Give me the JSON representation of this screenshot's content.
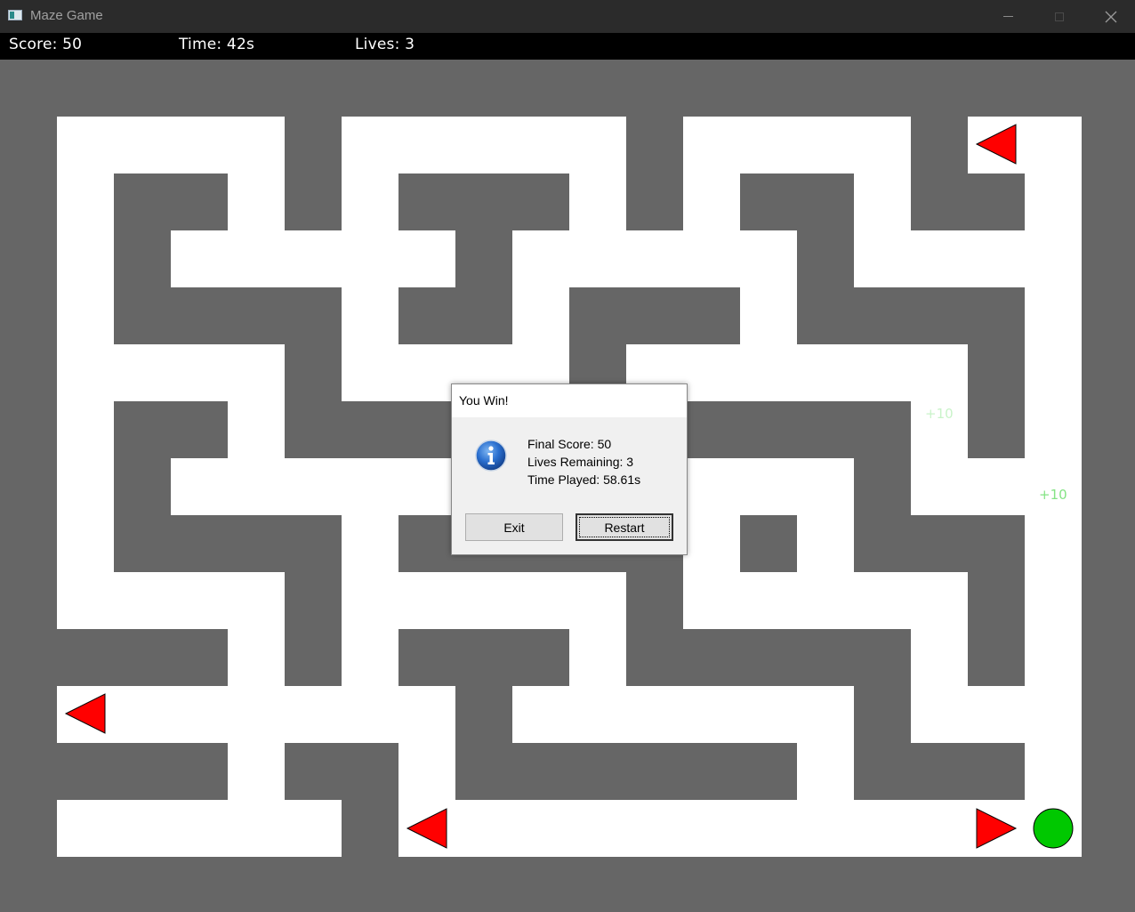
{
  "window": {
    "title": "Maze Game",
    "icon": "app-window-icon",
    "controls": [
      "minimize-icon",
      "maximize-icon",
      "close-icon"
    ]
  },
  "hud": {
    "score": "Score: 50",
    "time": "Time: 42s",
    "lives": "Lives: 3"
  },
  "maze": {
    "wall_color": "#666666",
    "path_color": "#ffffff",
    "rows": [
      "##############################",
      "#########.............#########",
      "#.......#.....#.....#...####...#",
      "#...###.#....##.....#....###...#",
      "#.#.##......#...##..........#..#",
      "#...#.......#.#....##.....#....#",
      "#..###.......#...#.#.....#..#..#",
      "..#....#.#....#........##..#.#..",
      "..#....#.#..........#.#.#..###.#",
      ".......#.#...........#.#.#...#..",
      "#######...........##.....##.....#"
    ]
  },
  "entities": {
    "enemies": [
      {
        "id": "enemy-1",
        "direction": "left",
        "color": "#ff0000"
      },
      {
        "id": "enemy-2",
        "direction": "left",
        "color": "#ff0000"
      },
      {
        "id": "enemy-3",
        "direction": "left",
        "color": "#ff0000"
      },
      {
        "id": "enemy-4",
        "direction": "right",
        "color": "#ff0000"
      }
    ],
    "player": {
      "color": "#00c800"
    }
  },
  "floating_text": {
    "first": "+10",
    "second": "+10"
  },
  "dialog": {
    "title": "You Win!",
    "icon": "info-icon",
    "lines": [
      "Final Score: 50",
      "Lives Remaining: 3",
      "Time Played: 58.61s"
    ],
    "buttons": {
      "exit": "Exit",
      "restart": "Restart"
    }
  }
}
